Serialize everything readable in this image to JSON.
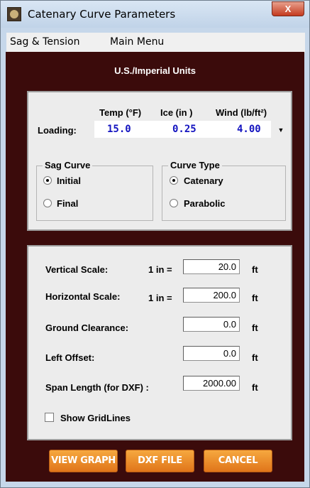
{
  "window": {
    "title": "Catenary Curve Parameters",
    "close_label": "X"
  },
  "menu": {
    "items": [
      "Sag & Tension",
      "Main Menu"
    ]
  },
  "units_label": "U.S./Imperial Units",
  "loading": {
    "label": "Loading:",
    "headers": {
      "temp": "Temp (°F)",
      "ice": "Ice (in )",
      "wind": "Wind (lb/ft²)"
    },
    "values": {
      "temp": "15.0",
      "ice": "0.25",
      "wind": "4.00"
    }
  },
  "sag_curve": {
    "title": "Sag Curve",
    "options": [
      "Initial",
      "Final"
    ],
    "selected": "Initial"
  },
  "curve_type": {
    "title": "Curve Type",
    "options": [
      "Catenary",
      "Parabolic"
    ],
    "selected": "Catenary"
  },
  "scales": {
    "vertical": {
      "label": "Vertical Scale:",
      "prefix": "1 in =",
      "value": "20.0",
      "unit": "ft"
    },
    "horizontal": {
      "label": "Horizontal Scale:",
      "prefix": "1 in =",
      "value": "200.0",
      "unit": "ft"
    },
    "ground_clearance": {
      "label": "Ground Clearance:",
      "value": "0.0",
      "unit": "ft"
    },
    "left_offset": {
      "label": "Left Offset:",
      "value": "0.0",
      "unit": "ft"
    },
    "span_length": {
      "label": "Span Length (for DXF) :",
      "value": "2000.00",
      "unit": "ft"
    }
  },
  "show_gridlines": {
    "label": "Show GridLines",
    "checked": false
  },
  "buttons": {
    "view_graph": "VIEW GRAPH",
    "dxf_file": "DXF FILE",
    "cancel": "CANCEL"
  },
  "colors": {
    "background": "#3b0b0b",
    "panel": "#ececec",
    "value_text": "#1414c0",
    "button": "#f0901f"
  }
}
